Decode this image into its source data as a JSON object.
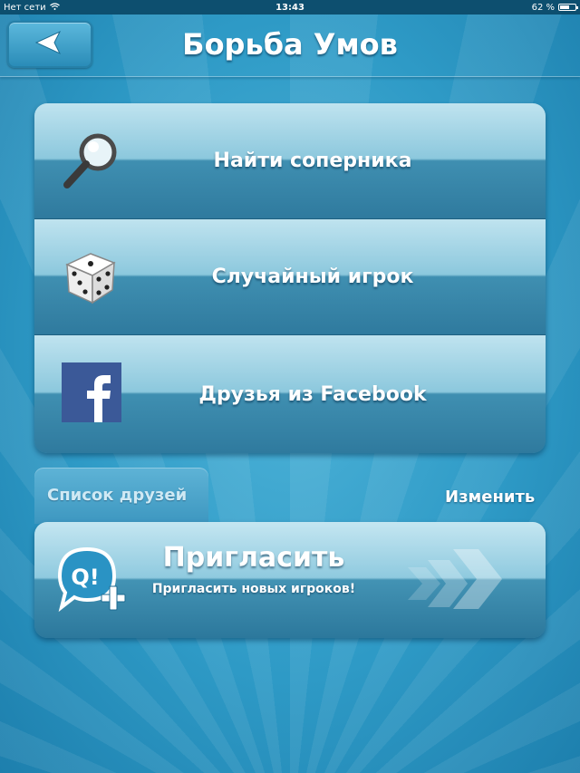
{
  "status_bar": {
    "carrier": "Нет сети",
    "time": "13:43",
    "battery": "62 %",
    "battery_level": 0.62
  },
  "header": {
    "title": "Борьба Умов",
    "back_icon": "back-arrow-icon"
  },
  "menu": {
    "items": [
      {
        "label": "Найти соперника",
        "icon": "magnifier-icon"
      },
      {
        "label": "Случайный игрок",
        "icon": "dice-icon"
      },
      {
        "label": "Друзья из Facebook",
        "icon": "facebook-icon"
      }
    ]
  },
  "friends": {
    "tab_label": "Список друзей",
    "edit_label": "Изменить"
  },
  "invite": {
    "title": "Пригласить",
    "subtitle": "Пригласить новых игроков!",
    "icon": "q-invite-icon",
    "icon_text": "Q!"
  },
  "colors": {
    "background": "#2e9ac6",
    "status_bar": "#0d4f6f",
    "facebook": "#3b5998"
  }
}
